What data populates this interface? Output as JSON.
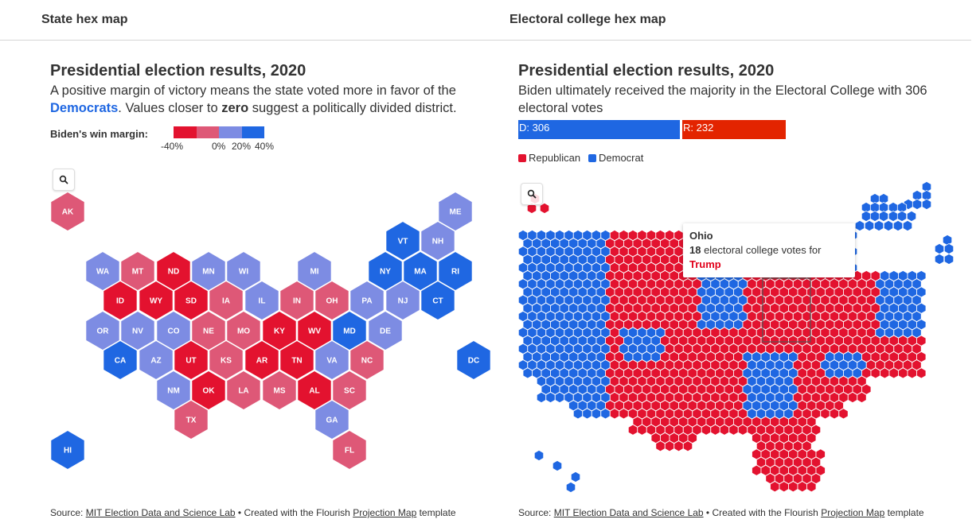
{
  "tabs": [
    {
      "label": "State hex map"
    },
    {
      "label": "Electoral college hex map"
    }
  ],
  "left": {
    "title": "Presidential election results, 2020",
    "sub_1": "A positive margin of victory means the state voted more in favor of the",
    "sub_dem": "Democrats",
    "sub_2": ". Values closer to ",
    "sub_zero": "zero",
    "sub_3": " suggest a politically divided district.",
    "legend_label": "Biden's win margin:",
    "legend_ticks": [
      "-40%",
      "0%",
      "20%",
      "40%"
    ],
    "legend_colors": [
      "#e3122f",
      "#de5877",
      "#7d8ce3",
      "#1f67e2"
    ],
    "source_prefix": "Source: ",
    "source_link": "MIT Election Data and Science Lab",
    "source_mid": " • Created with the Flourish ",
    "source_template": "Projection Map",
    "source_suffix": " template",
    "states": [
      {
        "abbr": "AK",
        "margin": -10.1
      },
      {
        "abbr": "ME",
        "margin": 9.1
      },
      {
        "abbr": "VT",
        "margin": 35.4
      },
      {
        "abbr": "NH",
        "margin": 7.4
      },
      {
        "abbr": "WA",
        "margin": 19.2
      },
      {
        "abbr": "MT",
        "margin": -16.4
      },
      {
        "abbr": "ND",
        "margin": -33.4
      },
      {
        "abbr": "MN",
        "margin": 7.1
      },
      {
        "abbr": "WI",
        "margin": 0.6
      },
      {
        "abbr": "MI",
        "margin": 2.8
      },
      {
        "abbr": "NY",
        "margin": 23.1
      },
      {
        "abbr": "MA",
        "margin": 33.5
      },
      {
        "abbr": "RI",
        "margin": 20.8
      },
      {
        "abbr": "ID",
        "margin": -30.8
      },
      {
        "abbr": "WY",
        "margin": -43.4
      },
      {
        "abbr": "SD",
        "margin": -26.2
      },
      {
        "abbr": "IA",
        "margin": -8.2
      },
      {
        "abbr": "IL",
        "margin": 17.0
      },
      {
        "abbr": "IN",
        "margin": -16.1
      },
      {
        "abbr": "OH",
        "margin": -8.0
      },
      {
        "abbr": "PA",
        "margin": 1.2
      },
      {
        "abbr": "NJ",
        "margin": 15.9
      },
      {
        "abbr": "CT",
        "margin": 20.0
      },
      {
        "abbr": "OR",
        "margin": 16.1
      },
      {
        "abbr": "NV",
        "margin": 2.4
      },
      {
        "abbr": "CO",
        "margin": 13.5
      },
      {
        "abbr": "NE",
        "margin": -19.1
      },
      {
        "abbr": "MO",
        "margin": -15.4
      },
      {
        "abbr": "KY",
        "margin": -25.9
      },
      {
        "abbr": "WV",
        "margin": -38.9
      },
      {
        "abbr": "MD",
        "margin": 33.2
      },
      {
        "abbr": "DE",
        "margin": 19.0
      },
      {
        "abbr": "CA",
        "margin": 29.2
      },
      {
        "abbr": "AZ",
        "margin": 0.3
      },
      {
        "abbr": "UT",
        "margin": -20.5
      },
      {
        "abbr": "KS",
        "margin": -14.6
      },
      {
        "abbr": "AR",
        "margin": -27.6
      },
      {
        "abbr": "TN",
        "margin": -23.2
      },
      {
        "abbr": "VA",
        "margin": 10.1
      },
      {
        "abbr": "NC",
        "margin": -1.3
      },
      {
        "abbr": "DC",
        "margin": 86.8
      },
      {
        "abbr": "NM",
        "margin": 10.8
      },
      {
        "abbr": "OK",
        "margin": -33.1
      },
      {
        "abbr": "LA",
        "margin": -18.6
      },
      {
        "abbr": "MS",
        "margin": -16.5
      },
      {
        "abbr": "AL",
        "margin": -25.5
      },
      {
        "abbr": "SC",
        "margin": -11.7
      },
      {
        "abbr": "TX",
        "margin": -5.6
      },
      {
        "abbr": "GA",
        "margin": 0.2
      },
      {
        "abbr": "HI",
        "margin": 29.5
      },
      {
        "abbr": "FL",
        "margin": -3.4
      }
    ]
  },
  "right": {
    "title": "Presidential election results, 2020",
    "sub": "Biden ultimately received the majority in the Electoral College with 306 electoral votes",
    "bar_dem_label": "D: 306",
    "bar_rep_label": "R: 232",
    "dem_votes": 306,
    "rep_votes": 232,
    "key_rep": "Republican",
    "key_dem": "Democrat",
    "rep_color": "#e3122f",
    "dem_color": "#1f67e2",
    "bar_rep_color": "#e32400",
    "tooltip_state": "Ohio",
    "tooltip_votes": "18",
    "tooltip_text": " electoral college votes for",
    "tooltip_winner": "Trump",
    "source_prefix": "Source: ",
    "source_link": "MIT Election Data and Science Lab",
    "source_mid": " • Created with the Flourish ",
    "source_template": "Projection Map",
    "source_suffix": " template"
  },
  "icons": {
    "zoom": "magnifier-icon"
  }
}
